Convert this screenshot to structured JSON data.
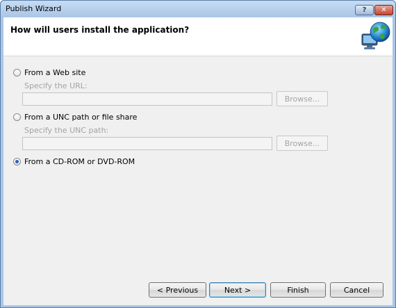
{
  "window": {
    "title": "Publish Wizard",
    "help_glyph": "?",
    "close_glyph": "✕"
  },
  "header": {
    "title": "How will users install the application?"
  },
  "options": [
    {
      "label": "From a Web site",
      "hint": "Specify the URL:",
      "field_value": "",
      "browse_label": "Browse...",
      "checked": false
    },
    {
      "label": "From a UNC path or file share",
      "hint": "Specify the UNC path:",
      "field_value": "",
      "browse_label": "Browse...",
      "checked": false
    },
    {
      "label": "From a CD-ROM or DVD-ROM",
      "checked": true
    }
  ],
  "footer": {
    "previous_label": "< Previous",
    "next_label": "Next >",
    "finish_label": "Finish",
    "cancel_label": "Cancel"
  },
  "colors": {
    "accent": "#2a62b8",
    "disabled_text": "#a3a3a3"
  },
  "icons": {
    "header": "globe-computer-icon"
  }
}
